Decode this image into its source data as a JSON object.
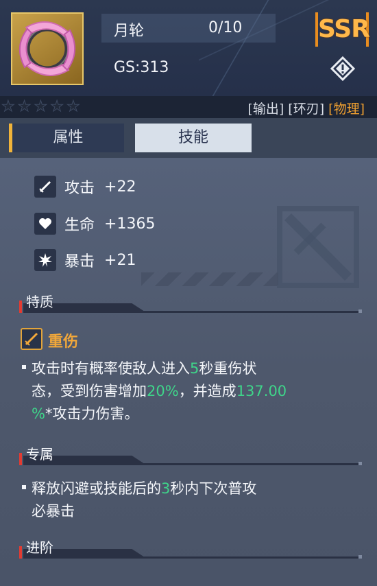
{
  "item": {
    "name": "月轮",
    "count": "0/10",
    "gs": "GS:313",
    "rarity": "SSR",
    "stars_total": 5,
    "tags": [
      "[输出]",
      "[环刃]",
      "[物理]"
    ]
  },
  "tabs": [
    {
      "label": "属性",
      "active": true
    },
    {
      "label": "技能",
      "active": false
    }
  ],
  "stats": [
    {
      "icon": "sword-icon",
      "label": "攻击",
      "value": "+22"
    },
    {
      "icon": "heart-icon",
      "label": "生命",
      "value": "+1365"
    },
    {
      "icon": "burst-icon",
      "label": "暴击",
      "value": "+21"
    }
  ],
  "sections": {
    "trait_title": "特质",
    "exclusive_title": "专属",
    "advance_title": "进阶"
  },
  "trait": {
    "name": "重伤",
    "desc_line1_a": "攻击时有概率使敌人进入",
    "desc_line1_num": "5",
    "desc_line1_b": "秒重伤状",
    "desc_line2_a": "态，受到伤害增加",
    "desc_line2_num": "20%",
    "desc_line2_b": "，并造成",
    "desc_line2_num2": "137.00",
    "desc_line3_num": "%",
    "desc_line3_b": "*攻击力伤害。"
  },
  "exclusive": {
    "line1_a": "释放闪避或技能后的",
    "line1_num": "3",
    "line1_b": "秒内下次普攻",
    "line2": "必暴击"
  },
  "colors": {
    "highlight_green": "#3fd58a",
    "rarity_orange": "#f5b53a",
    "trait_gold": "#f2a83a",
    "section_red": "#e23b32"
  }
}
